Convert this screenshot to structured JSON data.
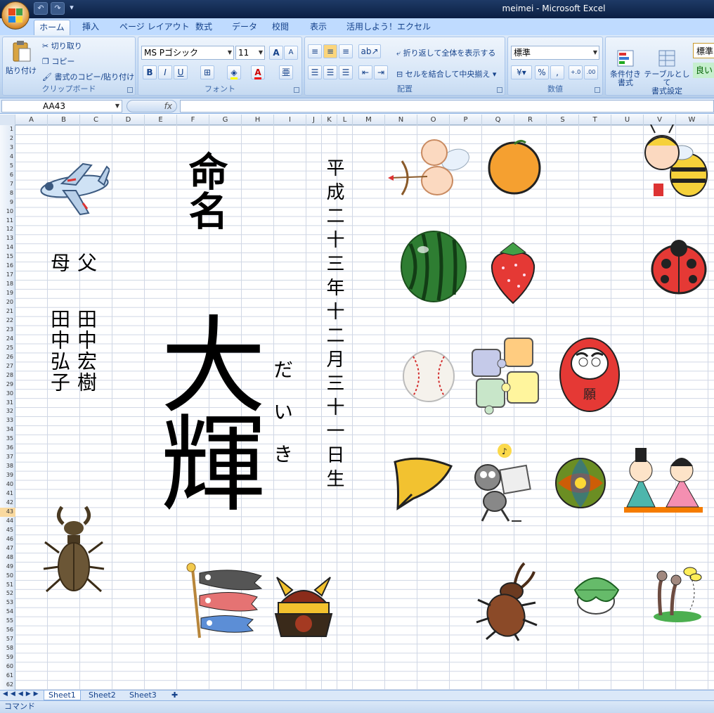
{
  "window": {
    "title": "meimei - Microsoft Excel"
  },
  "qat": {
    "undo": "↶",
    "redo": "↷",
    "customize": "▾"
  },
  "tabs": [
    "ホーム",
    "挿入",
    "ページ レイアウト",
    "数式",
    "データ",
    "校閲",
    "表示",
    "活用しよう！エクセル"
  ],
  "ribbon": {
    "clipboard": {
      "paste": "貼り付け",
      "cut": "切り取り",
      "copy": "コピー",
      "format_painter": "書式のコピー/貼り付け",
      "label": "クリップボード"
    },
    "font": {
      "name": "MS Pゴシック",
      "size": "11",
      "grow": "A",
      "shrink": "A",
      "bold": "B",
      "italic": "I",
      "underline": "U",
      "label": "フォント"
    },
    "alignment": {
      "wrap": "折り返して全体を表示する",
      "merge": "セルを結合して中央揃え",
      "label": "配置"
    },
    "number": {
      "format": "標準",
      "percent": "%",
      "comma": ",",
      "inc_decimal": "+.0",
      "dec_decimal": ".00",
      "label": "数値"
    },
    "styles": {
      "conditional": "条件付き\n書式",
      "as_table": "テーブルとして\n書式設定",
      "style_box": "標準",
      "good": "良い"
    }
  },
  "formula_bar": {
    "name_box": "AA43",
    "fx": "fx",
    "value": ""
  },
  "columns": [
    "A",
    "B",
    "C",
    "D",
    "E",
    "F",
    "G",
    "H",
    "I",
    "J",
    "K",
    "L",
    "M",
    "N",
    "O",
    "P",
    "Q",
    "R",
    "S",
    "T",
    "U",
    "V",
    "W"
  ],
  "rows": {
    "first": 1,
    "last": 62,
    "selected": 43
  },
  "content": {
    "heading": "命名",
    "name": "大輝",
    "reading": "だいき",
    "date": "平成二十三年十二月三十一日生",
    "father_label": "父",
    "mother_label": "母",
    "father_name": "田中宏樹",
    "mother_name": "田中弘子"
  },
  "sheets": [
    "Sheet1",
    "Sheet2",
    "Sheet3"
  ],
  "status": {
    "mode": "コマンド"
  }
}
